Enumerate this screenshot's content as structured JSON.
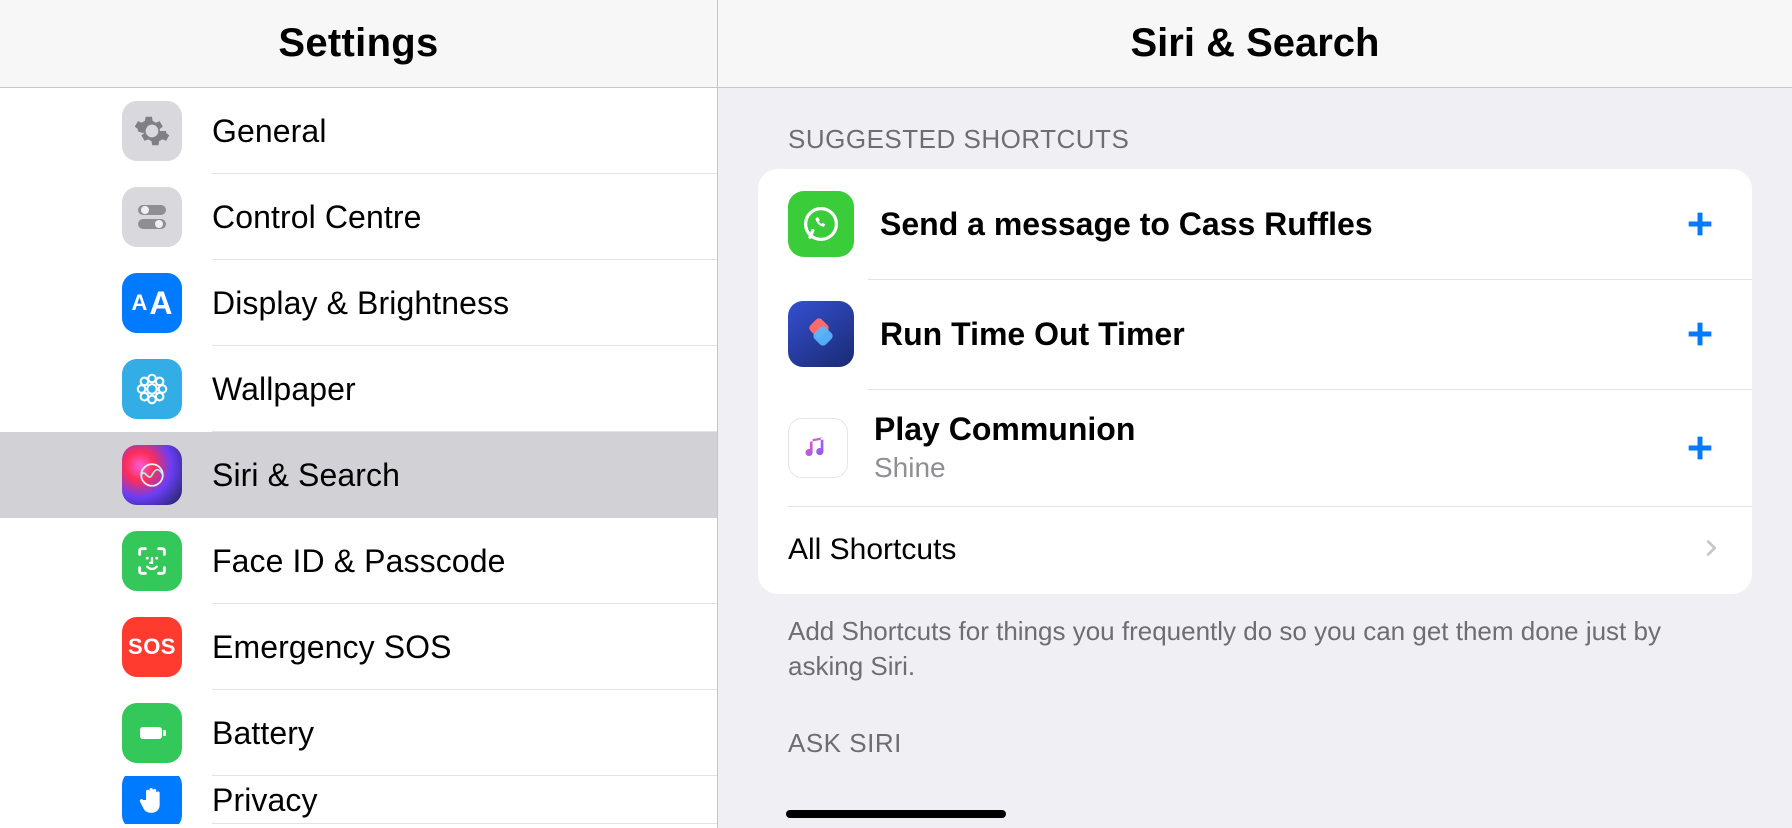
{
  "sidebar": {
    "title": "Settings",
    "items": [
      {
        "label": "General",
        "icon": "gear-icon"
      },
      {
        "label": "Control Centre",
        "icon": "toggles-icon"
      },
      {
        "label": "Display & Brightness",
        "icon": "text-size-icon"
      },
      {
        "label": "Wallpaper",
        "icon": "flower-icon"
      },
      {
        "label": "Siri & Search",
        "icon": "siri-icon",
        "selected": true
      },
      {
        "label": "Face ID & Passcode",
        "icon": "face-id-icon"
      },
      {
        "label": "Emergency SOS",
        "icon": "sos-icon"
      },
      {
        "label": "Battery",
        "icon": "battery-icon"
      },
      {
        "label": "Privacy",
        "icon": "hand-icon"
      }
    ]
  },
  "detail": {
    "title": "Siri & Search",
    "suggested_shortcuts_header": "SUGGESTED SHORTCUTS",
    "shortcuts": [
      {
        "title": "Send a message to Cass Ruffles",
        "subtitle": "",
        "icon": "whatsapp-icon"
      },
      {
        "title": "Run Time Out Timer",
        "subtitle": "",
        "icon": "shortcuts-icon"
      },
      {
        "title": "Play Communion",
        "subtitle": "Shine",
        "icon": "apple-music-icon"
      }
    ],
    "all_shortcuts_label": "All Shortcuts",
    "footer_text": "Add Shortcuts for things you frequently do so you can get them done just by asking Siri.",
    "ask_siri_header": "ASK SIRI"
  }
}
